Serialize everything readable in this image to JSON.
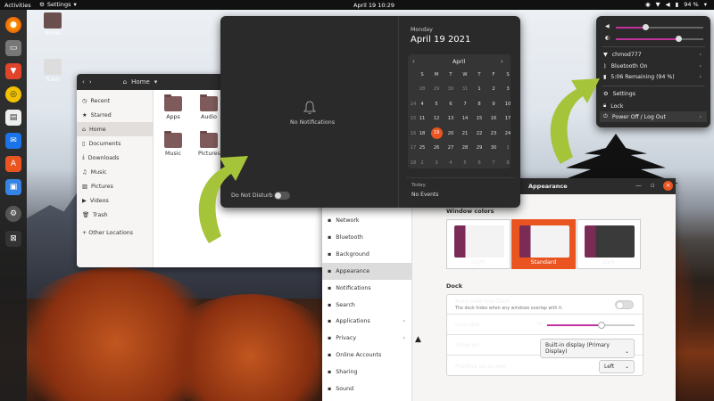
{
  "topbar": {
    "activities": "Activities",
    "app_menu": "Settings",
    "clock": "April 19  10:29",
    "battery": "94 %"
  },
  "desktop": {
    "icons": [
      {
        "label": "Home"
      },
      {
        "label": "Trash"
      }
    ]
  },
  "files": {
    "path": "Home",
    "sidebar": [
      "Recent",
      "Starred",
      "Home",
      "Documents",
      "Downloads",
      "Music",
      "Pictures",
      "Videos",
      "Trash",
      "+ Other Locations"
    ],
    "folders": [
      "Apps",
      "Audio",
      "Music",
      "Pictures"
    ]
  },
  "notifications": {
    "empty_text": "No Notifications",
    "dnd_label": "Do Not Disturb",
    "weekday": "Monday",
    "date": "April 19 2021",
    "month": "April",
    "prev": "‹",
    "next": "›",
    "weekdays": [
      "S",
      "M",
      "T",
      "W",
      "T",
      "F",
      "S"
    ],
    "weeks": [
      {
        "wk": "",
        "days": [
          "28",
          "29",
          "30",
          "31",
          "1",
          "2",
          "3"
        ]
      },
      {
        "wk": "14",
        "days": [
          "4",
          "5",
          "6",
          "7",
          "8",
          "9",
          "10"
        ]
      },
      {
        "wk": "15",
        "days": [
          "11",
          "12",
          "13",
          "14",
          "15",
          "16",
          "17"
        ]
      },
      {
        "wk": "16",
        "days": [
          "18",
          "19",
          "20",
          "21",
          "22",
          "23",
          "24"
        ]
      },
      {
        "wk": "17",
        "days": [
          "25",
          "26",
          "27",
          "28",
          "29",
          "30",
          "1"
        ]
      },
      {
        "wk": "18",
        "days": [
          "2",
          "3",
          "4",
          "5",
          "6",
          "7",
          "8"
        ]
      }
    ],
    "today_label": "Today",
    "no_events": "No Events"
  },
  "settings": {
    "title": "Appearance",
    "sidebar": [
      {
        "label": "Network",
        "icon": "network-icon",
        "chevron": ""
      },
      {
        "label": "Bluetooth",
        "icon": "bluetooth-icon",
        "chevron": ""
      },
      {
        "label": "Background",
        "icon": "background-icon",
        "chevron": ""
      },
      {
        "label": "Appearance",
        "icon": "appearance-icon",
        "chevron": ""
      },
      {
        "label": "Notifications",
        "icon": "notifications-icon",
        "chevron": ""
      },
      {
        "label": "Search",
        "icon": "search-icon",
        "chevron": ""
      },
      {
        "label": "Applications",
        "icon": "applications-icon",
        "chevron": "›"
      },
      {
        "label": "Privacy",
        "icon": "privacy-icon",
        "chevron": "›"
      },
      {
        "label": "Online Accounts",
        "icon": "online-accounts-icon",
        "chevron": ""
      },
      {
        "label": "Sharing",
        "icon": "sharing-icon",
        "chevron": ""
      },
      {
        "label": "Sound",
        "icon": "sound-icon",
        "chevron": ""
      }
    ],
    "window_colors_title": "Window colors",
    "themes": [
      "Light",
      "Standard",
      "Dark"
    ],
    "dock_title": "Dock",
    "autohide_label": "Auto-hide the Dock",
    "autohide_desc": "The dock hides when any windows overlap with it.",
    "icon_size_label": "Icon size",
    "icon_size_value": "48",
    "icon_size_fraction": 0.62,
    "show_on_label": "Show on",
    "show_on_value": "Built-in display (Primary Display)",
    "position_label": "Position on screen",
    "position_value": "Left"
  },
  "quick": {
    "volume_fraction": 0.35,
    "brightness_fraction": 0.72,
    "wifi": "chmod777",
    "bluetooth": "Bluetooth On",
    "battery": "5:06 Remaining (94 %)",
    "settings": "Settings",
    "lock": "Lock",
    "power": "Power Off / Log Out"
  },
  "colors": {
    "accent": "#e95420",
    "arrow": "#a6c43a",
    "slider": "#c2329e"
  }
}
